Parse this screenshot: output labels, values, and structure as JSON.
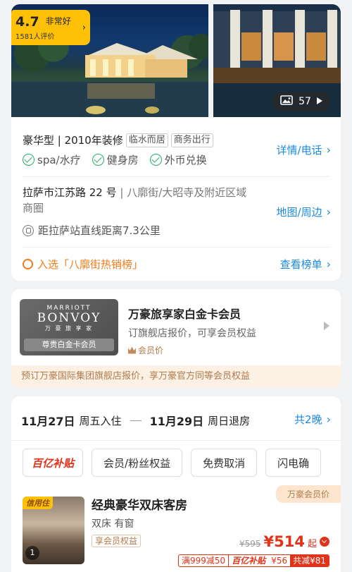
{
  "photos": {
    "rating": {
      "score": "4.7",
      "word": "非常好",
      "count": "1581人评价"
    },
    "photo_count": "57"
  },
  "info": {
    "room_type": "豪华型 | 2010年装修",
    "tags": [
      "临水而居",
      "商务出行"
    ],
    "amenities": [
      "spa/水疗",
      "健身房",
      "外币兑换"
    ],
    "details_link": "详情/电话",
    "address_main": "拉萨市江苏路 22 号",
    "address_sub": " | 八廓街/大昭寺及附近区域商圈",
    "map_link": "地图/周边",
    "station": "距拉萨站直线距离7.3公里",
    "ranking": "入选「八廓街热销榜」",
    "ranking_link": "查看榜单"
  },
  "membership": {
    "card_brand": "MARRIOTT",
    "card_name": "BONVOY",
    "card_sub": "万 豪 旅 享 家",
    "card_tier": "尊贵白金卡会员",
    "title": "万豪旅享家白金卡会员",
    "desc": "订旗舰店报价，可享会员权益",
    "price_label": "会员价",
    "banner": "预订万豪国际集团旗舰店报价，享万豪官方同等会员权益"
  },
  "booking": {
    "checkin_date": "11月27日",
    "checkin_label": "周五入住",
    "checkout_date": "11月29日",
    "checkout_label": "周日退房",
    "nights": "共2晚",
    "filters": [
      "百亿补贴",
      "会员/粉丝权益",
      "免费取消",
      "闪电确"
    ],
    "vip_tag": "万豪会员价",
    "room": {
      "credit_tag": "信用住",
      "image_count": "1",
      "name": "经典豪华双床客房",
      "detail": "双床 有窗",
      "benefit": "享会员权益",
      "price_old": "¥595",
      "price_new": "¥514",
      "price_suffix": "起",
      "discounts": [
        "满999减50",
        "百亿补贴",
        "¥56",
        "共减¥81"
      ]
    }
  }
}
